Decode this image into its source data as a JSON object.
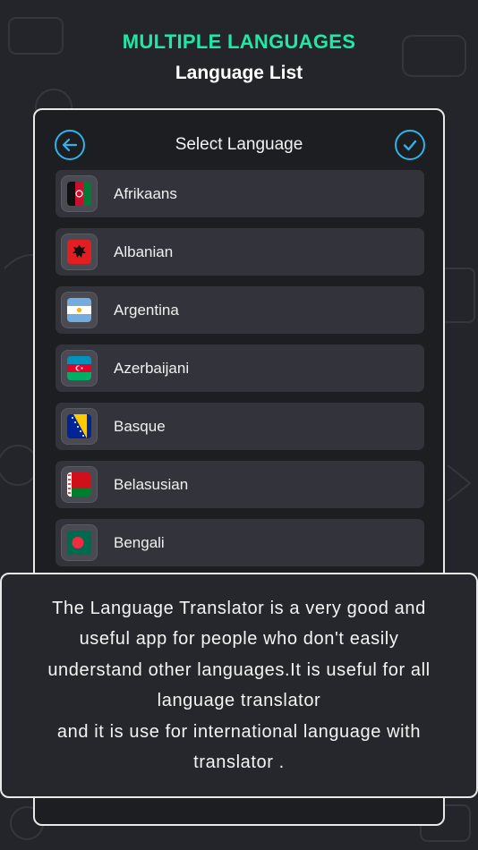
{
  "headline": "MULTIPLE LANGUAGES",
  "subheadline": "Language List",
  "colors": {
    "headline": "#1de9a6",
    "accent_icon": "#2fb3e8",
    "background": "#24252a",
    "card_bg": "#1d1e22",
    "item_bg": "#33343b"
  },
  "card": {
    "title": "Select Language",
    "back_icon": "back-arrow-icon",
    "done_icon": "check-icon"
  },
  "languages": [
    {
      "label": "Afrikaans",
      "flag": "afghanistan-flag-icon"
    },
    {
      "label": "Albanian",
      "flag": "albania-flag-icon"
    },
    {
      "label": "Argentina",
      "flag": "argentina-flag-icon"
    },
    {
      "label": "Azerbaijani",
      "flag": "azerbaijan-flag-icon"
    },
    {
      "label": "Basque",
      "flag": "bosnia-flag-icon"
    },
    {
      "label": "Belasusian",
      "flag": "belarus-flag-icon"
    },
    {
      "label": "Bengali",
      "flag": "bangladesh-flag-icon"
    }
  ],
  "info_text": "The Language Translator is a very good and\nuseful app for people who don't easily\nunderstand other languages.It is useful for all\nlanguage translator\nand it is use for international language with\ntranslator ."
}
